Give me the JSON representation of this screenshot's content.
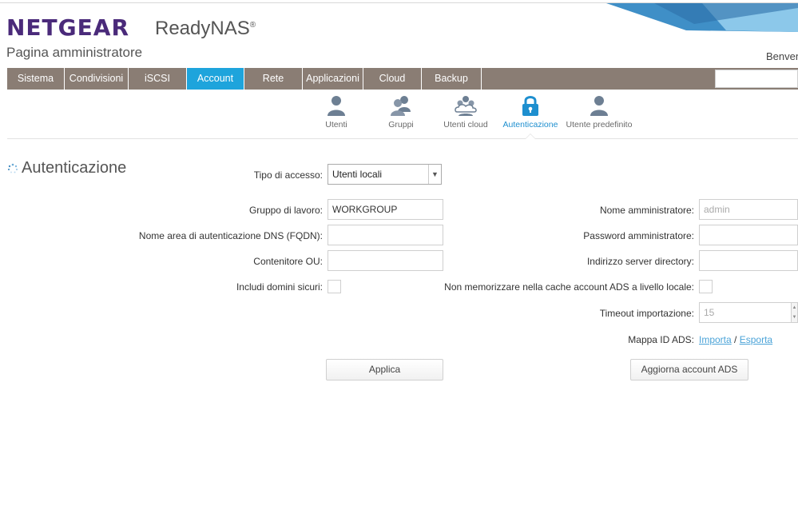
{
  "header": {
    "brand": "NETGEAR",
    "product": "ReadyNAS",
    "product_mark": "®",
    "subtitle": "Pagina amministratore",
    "welcome": "Benvenuto"
  },
  "nav": {
    "tabs": [
      {
        "label": "Sistema"
      },
      {
        "label": "Condivisioni"
      },
      {
        "label": "iSCSI"
      },
      {
        "label": "Account",
        "active": true
      },
      {
        "label": "Rete"
      },
      {
        "label": "Applicazioni"
      },
      {
        "label": "Cloud"
      },
      {
        "label": "Backup"
      }
    ]
  },
  "subnav": {
    "items": [
      {
        "label": "Utenti",
        "icon": "user-icon"
      },
      {
        "label": "Gruppi",
        "icon": "group-icon"
      },
      {
        "label": "Utenti cloud",
        "icon": "cloud-users-icon"
      },
      {
        "label": "Autenticazione",
        "icon": "lock-icon",
        "active": true
      },
      {
        "label": "Utente predefinito",
        "icon": "default-user-icon"
      }
    ]
  },
  "page": {
    "title": "Autenticazione"
  },
  "form": {
    "access_type_label": "Tipo di accesso:",
    "access_type_value": "Utenti locali",
    "workgroup_label": "Gruppo di lavoro:",
    "workgroup_value": "WORKGROUP",
    "dns_realm_label": "Nome area di autenticazione DNS (FQDN):",
    "dns_realm_value": "",
    "ou_label": "Contenitore OU:",
    "ou_value": "",
    "trusted_domains_label": "Includi domini sicuri:",
    "admin_name_label": "Nome amministratore:",
    "admin_name_placeholder": "admin",
    "admin_password_label": "Password amministratore:",
    "directory_server_label": "Indirizzo server directory:",
    "no_cache_label": "Non memorizzare nella cache account ADS a livello locale:",
    "import_timeout_label": "Timeout importazione:",
    "import_timeout_placeholder": "15",
    "ads_id_map_label": "Mappa ID ADS:",
    "import_link": "Importa",
    "separator": "/",
    "export_link": "Esporta",
    "apply_button": "Applica",
    "update_ads_button": "Aggiorna account ADS"
  },
  "colors": {
    "brand": "#4a2a7a",
    "nav_bg": "#8a7d74",
    "nav_active": "#1ea4dc",
    "subnav_active": "#1e8fcf",
    "link": "#4aa3d8"
  }
}
